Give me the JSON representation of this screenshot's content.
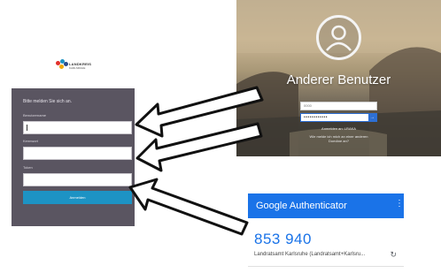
{
  "logo": {
    "line1": "LANDKREIS",
    "line2": "KARLSRUHE",
    "colors": [
      "#e2312b",
      "#1d93c4",
      "#2b4a8a",
      "#f2a900"
    ]
  },
  "login_panel": {
    "title": "Bitte melden Sie sich an.",
    "username_label": "Benutzername",
    "password_label": "Kennwort",
    "token_label": "Token",
    "submit_label": "Anmelden",
    "username_value": "",
    "password_value": "",
    "token_value": ""
  },
  "windows_lock": {
    "username_heading": "Anderer Benutzer",
    "user_field_value": "0000",
    "password_field_value": "••••••••••••",
    "submit_glyph": "→",
    "link1": "Anmelden an: LRAKA",
    "link2_line1": "Wie melde ich mich an einer anderen",
    "link2_line2": "Domäne an?"
  },
  "authenticator": {
    "app_title": "Google Authenticator",
    "menu_glyph": "⋮",
    "code": "853 940",
    "account": "Landratsamt Karlsruhe (Landratsamt+Karlsru...",
    "refresh_glyph": "↻",
    "accent_color": "#1a73e8"
  },
  "colors": {
    "panel_bg": "#5a5561",
    "submit_bg": "#1d93c4"
  }
}
